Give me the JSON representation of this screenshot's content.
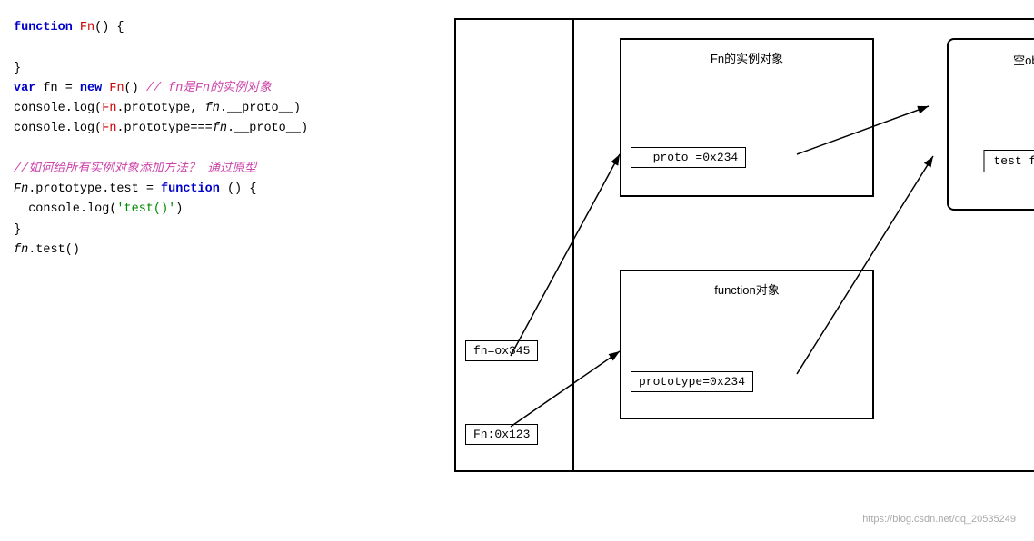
{
  "code": {
    "lines": [
      {
        "parts": [
          {
            "text": "function",
            "class": "kw"
          },
          {
            "text": " Fn() {",
            "class": ""
          }
        ]
      },
      {
        "parts": [
          {
            "text": "",
            "class": ""
          }
        ]
      },
      {
        "parts": [
          {
            "text": "}",
            "class": ""
          }
        ]
      },
      {
        "parts": [
          {
            "text": "var fn = new Fn() // fn是Fn的实例对象",
            "class": "comment-line",
            "segments": [
              {
                "text": "var",
                "class": "kw"
              },
              {
                "text": " fn = ",
                "class": ""
              },
              {
                "text": "new",
                "class": "kw"
              },
              {
                "text": " Fn() ",
                "class": ""
              },
              {
                "text": "// fn是Fn的实例对象",
                "class": "comment"
              }
            ]
          }
        ]
      },
      {
        "parts": [
          {
            "text": "console.log(Fn.prototype, ",
            "class": ""
          },
          {
            "text": "fn",
            "class": "italic"
          },
          {
            "text": ".__proto__)",
            "class": ""
          }
        ]
      },
      {
        "parts": [
          {
            "text": "console.log(Fn.prototype===",
            "class": ""
          },
          {
            "text": "fn",
            "class": "italic"
          },
          {
            "text": ".__proto__)",
            "class": ""
          }
        ]
      },
      {
        "parts": [
          {
            "text": "",
            "class": ""
          }
        ]
      },
      {
        "parts": [
          {
            "text": "//如何给所有实例对象添加方法？通过原型",
            "class": "comment"
          }
        ]
      },
      {
        "parts": [
          {
            "text": "Fn",
            "class": "italic"
          },
          {
            "text": ".prototype.test = ",
            "class": ""
          },
          {
            "text": "function",
            "class": "kw"
          },
          {
            "text": " () {",
            "class": ""
          }
        ]
      },
      {
        "parts": [
          {
            "text": "  console.log('test()')",
            "class": ""
          }
        ]
      },
      {
        "parts": [
          {
            "text": "}",
            "class": ""
          }
        ]
      },
      {
        "parts": [
          {
            "text": "fn",
            "class": "italic"
          },
          {
            "text": ".test()",
            "class": ""
          }
        ]
      }
    ]
  },
  "diagram": {
    "stack_fn_label": "fn=ox345",
    "stack_fn_cap_label": "Fn:0x123",
    "instance_title": "Fn的实例对象",
    "proto_label": "__proto_=0x234",
    "function_title": "function对象",
    "prototype_label": "prototype=0x234",
    "empty_obj_title": "空object对象",
    "test_fn_label": "test function()"
  },
  "watermark": "https://blog.csdn.net/qq_20535249"
}
